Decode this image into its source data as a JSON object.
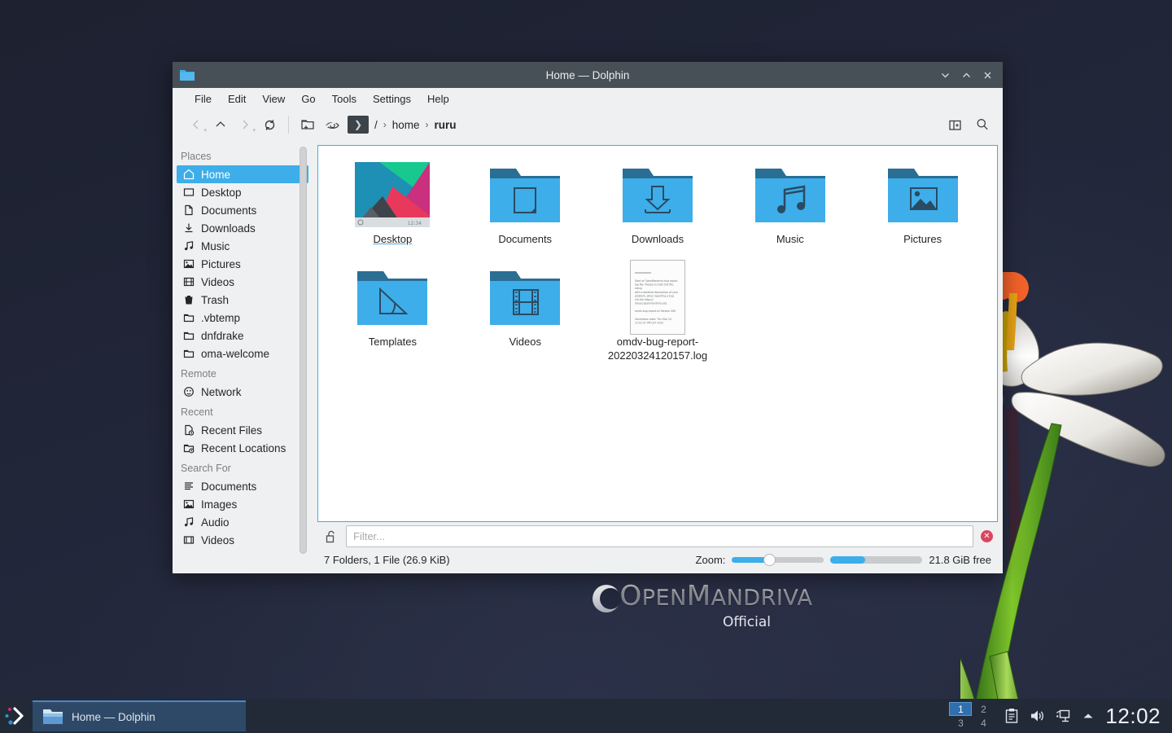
{
  "desktop": {
    "logo_main_a": "O",
    "logo_main_b": "PEN",
    "logo_main_c": "M",
    "logo_main_d": "ANDRIVA",
    "logo_sub": "Official",
    "wallpaper_color": "#212639",
    "accent_color": "#3daee9"
  },
  "window": {
    "title": "Home — Dolphin",
    "titlebar_color": "#475057",
    "buttons": {
      "minimize": "⌄",
      "maximize": "⌃",
      "close": "✕"
    }
  },
  "menubar": {
    "items": [
      "File",
      "Edit",
      "View",
      "Go",
      "Tools",
      "Settings",
      "Help"
    ]
  },
  "toolbar": {
    "back": "Back",
    "up": "Up",
    "forward": "Forward",
    "reload": "Reload",
    "new_folder": "Create New Folder",
    "hidden": "Show Hidden Files",
    "terminal_icon": "❯",
    "split": "Split View",
    "search": "Search"
  },
  "breadcrumb": {
    "root": "/",
    "sep": "›",
    "parts": [
      "home",
      "ruru"
    ]
  },
  "sidebar": {
    "groups": [
      {
        "title": "Places",
        "items": [
          {
            "label": "Home",
            "icon": "home-icon",
            "selected": true
          },
          {
            "label": "Desktop",
            "icon": "desktop-icon",
            "selected": false
          },
          {
            "label": "Documents",
            "icon": "document-icon",
            "selected": false
          },
          {
            "label": "Downloads",
            "icon": "download-icon",
            "selected": false
          },
          {
            "label": "Music",
            "icon": "music-icon",
            "selected": false
          },
          {
            "label": "Pictures",
            "icon": "picture-icon",
            "selected": false
          },
          {
            "label": "Videos",
            "icon": "video-icon",
            "selected": false
          },
          {
            "label": "Trash",
            "icon": "trash-icon",
            "selected": false
          },
          {
            "label": ".vbtemp",
            "icon": "folder-icon",
            "selected": false
          },
          {
            "label": "dnfdrake",
            "icon": "folder-icon",
            "selected": false
          },
          {
            "label": "oma-welcome",
            "icon": "folder-icon",
            "selected": false
          }
        ]
      },
      {
        "title": "Remote",
        "items": [
          {
            "label": "Network",
            "icon": "network-icon",
            "selected": false
          }
        ]
      },
      {
        "title": "Recent",
        "items": [
          {
            "label": "Recent Files",
            "icon": "recent-file-icon",
            "selected": false
          },
          {
            "label": "Recent Locations",
            "icon": "recent-folder-icon",
            "selected": false
          }
        ]
      },
      {
        "title": "Search For",
        "items": [
          {
            "label": "Documents",
            "icon": "text-lines-icon",
            "selected": false
          },
          {
            "label": "Images",
            "icon": "picture-icon",
            "selected": false
          },
          {
            "label": "Audio",
            "icon": "music-icon",
            "selected": false
          },
          {
            "label": "Videos",
            "icon": "video-icon",
            "selected": false
          }
        ]
      }
    ]
  },
  "files": [
    {
      "name": "Desktop",
      "kind": "thumbnail",
      "hover": true
    },
    {
      "name": "Documents",
      "kind": "folder-document"
    },
    {
      "name": "Downloads",
      "kind": "folder-download"
    },
    {
      "name": "Music",
      "kind": "folder-music"
    },
    {
      "name": "Pictures",
      "kind": "folder-picture"
    },
    {
      "name": "Templates",
      "kind": "folder-template"
    },
    {
      "name": "Videos",
      "kind": "folder-video"
    },
    {
      "name": "omdv-bug-report-20220324120157.log",
      "kind": "text-preview",
      "preview_lines": [
        "Start of OpenMandriva bug report",
        "log file.  Please include this file,",
        "along",
        "with a detailed description of your",
        "problem, when reporting a bug",
        "via the https://",
        "issues.openmandriva.org",
        "",
        "omdv-bug-report.sh Version 006",
        "",
        "Generation date: Thu Mar 24",
        "12:01:57 PM CET 2022"
      ]
    }
  ],
  "filter": {
    "placeholder": "Filter...",
    "value": "",
    "lock_icon": "unlock-icon",
    "close_icon": "close-icon"
  },
  "status": {
    "summary": "7 Folders, 1 File (26.9 KiB)",
    "zoom_label": "Zoom:",
    "zoom_percent": 40,
    "capacity_percent": 38,
    "free_space": "21.8 GiB free"
  },
  "taskbar": {
    "task_title": "Home — Dolphin",
    "pager": [
      "1",
      "2",
      "3",
      "4"
    ],
    "pager_active": "1",
    "tray_icons": [
      "clipboard-icon",
      "volume-icon",
      "network-icon",
      "show-hidden-icon"
    ],
    "clock": "12:02"
  }
}
